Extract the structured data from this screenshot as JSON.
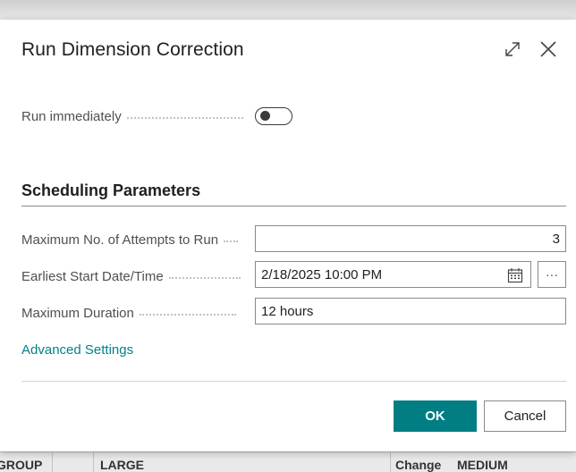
{
  "dialog": {
    "title": "Run Dimension Correction",
    "expand_icon": "expand-icon",
    "close_icon": "close-icon"
  },
  "run_immediately": {
    "label": "Run immediately",
    "value": false
  },
  "scheduling": {
    "heading": "Scheduling Parameters",
    "max_attempts": {
      "label": "Maximum No. of Attempts to Run",
      "value": "3"
    },
    "earliest_start": {
      "label": "Earliest Start Date/Time",
      "value": "2/18/2025 10:00 PM",
      "picker_icon": "calendar-icon",
      "assist_label": "···"
    },
    "max_duration": {
      "label": "Maximum Duration",
      "value": "12 hours"
    }
  },
  "advanced_link": "Advanced Settings",
  "buttons": {
    "ok": "OK",
    "cancel": "Cancel"
  },
  "background_table": {
    "cells": [
      "GROUP",
      "LARGE",
      "Change",
      "MEDIUM"
    ]
  },
  "colors": {
    "accent": "#007e84",
    "link": "#00828a"
  }
}
